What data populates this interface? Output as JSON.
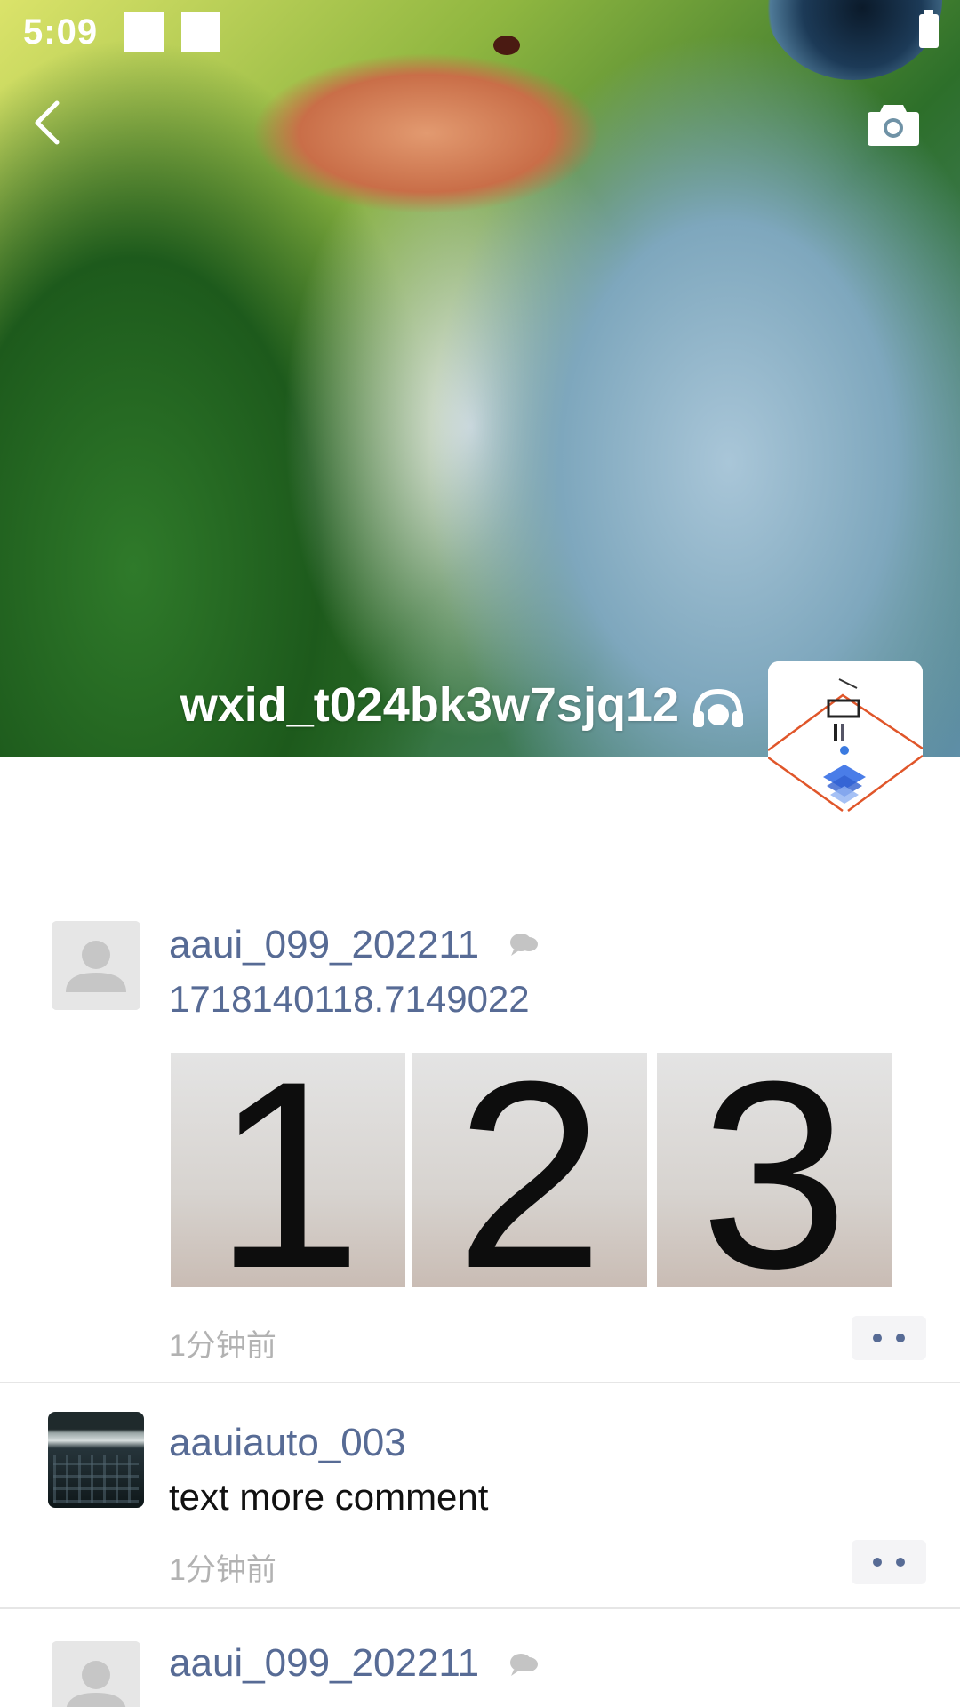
{
  "status_bar": {
    "time": "5:09"
  },
  "profile": {
    "name": "wxid_t024bk3w7sjq12"
  },
  "feed": {
    "posts": [
      {
        "username": "aaui_099_202211",
        "content": "1718140118.7149022",
        "photos": [
          "1",
          "2",
          "3"
        ],
        "time": "1分钟前"
      },
      {
        "username": "aauiauto_003",
        "content": "text more comment",
        "time": "1分钟前"
      },
      {
        "username": "aaui_099_202211"
      }
    ]
  },
  "colors": {
    "link_blue": "#576b95",
    "timestamp_gray": "#b2b2b2",
    "divider": "#e6e6e6"
  },
  "icons": [
    "back-icon",
    "camera-icon",
    "headset-icon",
    "cloud-icon",
    "more-icon"
  ]
}
